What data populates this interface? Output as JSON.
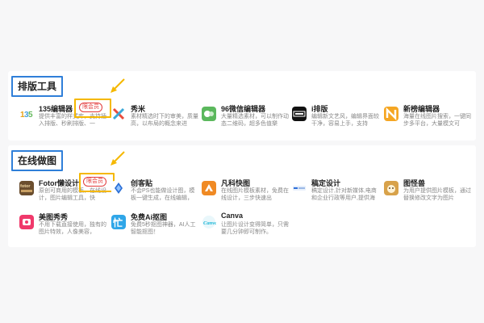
{
  "section1": {
    "title": "排版工具",
    "items": [
      {
        "name": "135编辑器",
        "desc": "提供丰富的样式库，支持插入排版、秒刷排版、一",
        "badge": "限会员",
        "icon": "135-logo-icon",
        "color": "#ffffff"
      },
      {
        "name": "秀米",
        "desc": "素材精选时下的审美，质量高，以布局的概念来进",
        "icon": "xiumi-logo-icon",
        "color": "#ffffff"
      },
      {
        "name": "96微信编辑器",
        "desc": "大量精选素材，可以制作动态二维码，超多色值樂",
        "icon": "96-logo-icon",
        "color": "#5bb85d"
      },
      {
        "name": "i排版",
        "desc": "编辑新文艺风，编辑界面较干净，容易上手，支持",
        "icon": "ipaiban-logo-icon",
        "color": "#111111"
      },
      {
        "name": "新榜编辑器",
        "desc": "海量在线图片搜索，一键同步多平台，大量模文可",
        "icon": "xinbang-logo-icon",
        "color": "#f5a623"
      }
    ]
  },
  "section2": {
    "title": "在线做图",
    "items": [
      {
        "name": "Fotor懒设计",
        "desc": "原创可商用的模板，在线设计，图片编辑工具，快",
        "badge": "限会员",
        "icon": "fotor-logo-icon",
        "color": "#6b4e2e"
      },
      {
        "name": "创客贴",
        "desc": "不会PS也能做设计图，模板一键生成，在线编辑，",
        "icon": "chuangketie-logo-icon",
        "color": "#ffffff"
      },
      {
        "name": "凡科快图",
        "desc": "在线图片模板素材，免费在线设计，三步快速出",
        "icon": "fanke-logo-icon",
        "color": "#f08a24"
      },
      {
        "name": "稿定设计",
        "desc": "稿定设计,针对新媒体,电商和企业行政等用户,提供海",
        "icon": "gaoding-logo-icon",
        "color": "#ffffff"
      },
      {
        "name": "图怪兽",
        "desc": "为用户提供图片模板，通过替换修改文字为图片",
        "icon": "tuguaishou-logo-icon",
        "color": "#d8a24a"
      },
      {
        "name": "美图秀秀",
        "desc": "不用下载直接使用，独有的图片特效，人像美容，",
        "icon": "meitu-logo-icon",
        "color": "#f0396b"
      },
      {
        "name": "免费Ai抠图",
        "desc": "免费5秒抠图神器，AI人工智能抠图！",
        "icon": "ai-koutu-logo-icon",
        "color": "#2fa6e8"
      },
      {
        "name": "Canva",
        "desc": "让图片设计变得简单，只需要几分钟即可制作。",
        "icon": "canva-logo-icon",
        "color": "#ffffff"
      }
    ]
  }
}
